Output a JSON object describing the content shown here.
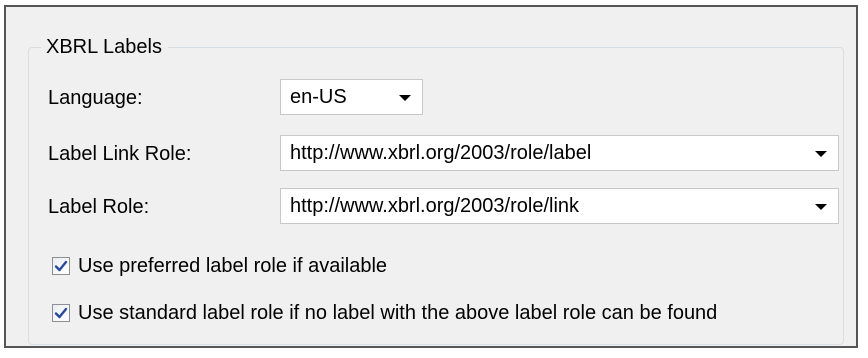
{
  "group": {
    "title": "XBRL Labels"
  },
  "language": {
    "label": "Language:",
    "value": "en-US"
  },
  "label_link_role": {
    "label": "Label Link Role:",
    "value": "http://www.xbrl.org/2003/role/label"
  },
  "label_role": {
    "label": "Label Role:",
    "value": "http://www.xbrl.org/2003/role/link"
  },
  "options": {
    "preferred": {
      "label": "Use preferred label role if available",
      "checked": true
    },
    "standard": {
      "label": "Use standard label role if no label with the above label role can be found",
      "checked": true
    }
  },
  "icons": {
    "dropdown": "chevron-down-icon",
    "check": "checkmark-icon"
  },
  "colors": {
    "window_bg": "#f0f0f0",
    "window_border": "#555555",
    "group_border": "#d5dfe5",
    "checkmark": "#2a4a9c"
  }
}
